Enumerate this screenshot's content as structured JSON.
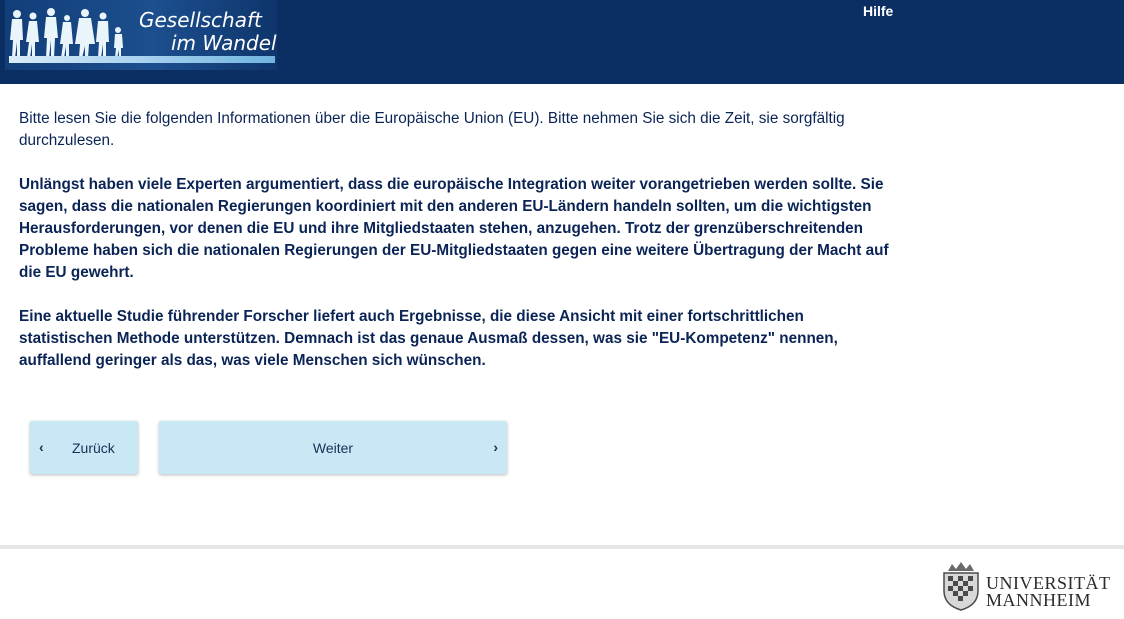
{
  "header": {
    "logo_line1": "Gesellschaft",
    "logo_line2": "im Wandel",
    "help_link": "Hilfe"
  },
  "content": {
    "paragraph1": "Bitte lesen Sie die folgenden Informationen über die Europäische Union (EU). Bitte nehmen Sie sich die Zeit, sie sorgfältig durchzulesen.",
    "paragraph2": "Unlängst haben viele Experten argumentiert, dass die europäische Integration weiter vorangetrieben werden sollte. Sie sagen, dass die nationalen Regierungen koordiniert mit den anderen EU-Ländern handeln sollten, um die wichtigsten Herausforderungen, vor denen die EU und ihre Mitgliedstaaten stehen, anzugehen. Trotz der grenzüberschreitenden Probleme haben sich die nationalen Regierungen der EU-Mitgliedstaaten gegen eine weitere Übertragung der Macht auf die EU gewehrt.",
    "paragraph3": "Eine aktuelle Studie führender Forscher liefert auch Ergebnisse, die diese Ansicht mit einer fortschrittlichen statistischen Methode unterstützen. Demnach ist das genaue Ausmaß dessen, was sie \"EU-Kompetenz\" nennen, auffallend geringer als das, was viele Menschen sich wünschen."
  },
  "navigation": {
    "back_label": "Zurück",
    "next_label": "Weiter",
    "back_icon": "chevron-left-icon",
    "next_icon": "chevron-right-icon"
  },
  "footer": {
    "university_line1": "UNIVERSITÄT",
    "university_line2": "MANNHEIM"
  },
  "colors": {
    "header_bg": "#0c2f63",
    "text": "#0b2456",
    "button_bg": "#c8e8f6"
  }
}
